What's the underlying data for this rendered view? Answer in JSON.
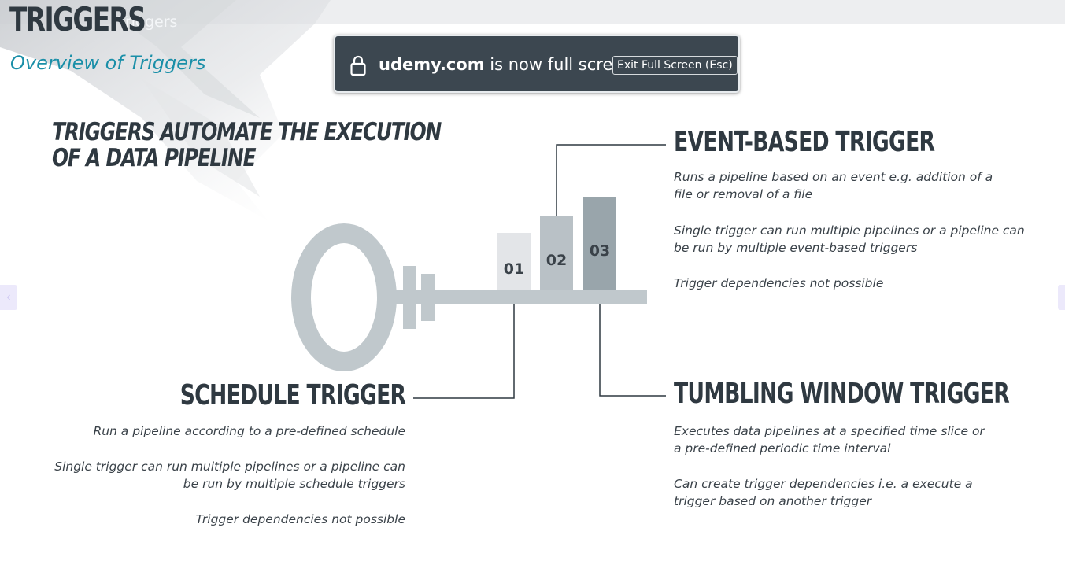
{
  "slide": {
    "title": "TRIGGERS",
    "ghost_breadcrumb": "Triggers",
    "subtitle": "Overview of Triggers",
    "headline": "TRIGGERS AUTOMATE THE EXECUTION OF A DATA PIPELINE"
  },
  "key": {
    "steps": [
      "01",
      "02",
      "03"
    ]
  },
  "sections": {
    "event": {
      "title": "EVENT-BASED TRIGGER",
      "points": [
        "Runs a pipeline based on an event e.g. addition of a file or removal of a file",
        "Single trigger can run multiple pipelines or a pipeline can be run by multiple event-based triggers",
        "Trigger dependencies not possible"
      ]
    },
    "schedule": {
      "title": "SCHEDULE TRIGGER",
      "points": [
        "Run a pipeline according to a pre-defined schedule",
        "Single trigger can run multiple pipelines or a pipeline can be run by multiple schedule triggers",
        "Trigger dependencies not possible"
      ]
    },
    "tumbling": {
      "title": "TUMBLING WINDOW TRIGGER",
      "points": [
        "Executes data pipelines at a specified time slice or a pre-defined periodic time interval",
        "Can create trigger dependencies i.e. a execute a trigger based on another trigger"
      ]
    }
  },
  "fullscreen_toast": {
    "domain": "udemy.com",
    "message": "is now full screen",
    "exit_label": "Exit Full Screen (Esc)",
    "icon": "lock-icon"
  },
  "nav": {
    "prev_icon": "chevron-left-icon",
    "prev_glyph": "‹",
    "next_icon": "chevron-right-icon"
  },
  "colors": {
    "heading": "#2f3941",
    "subtitle": "#1a8fa8",
    "key": "#c0c8cc",
    "step1": "#e3e5e8",
    "step2": "#b9c1c6",
    "step3": "#99a5ab",
    "toast_bg": "#3c4750"
  }
}
